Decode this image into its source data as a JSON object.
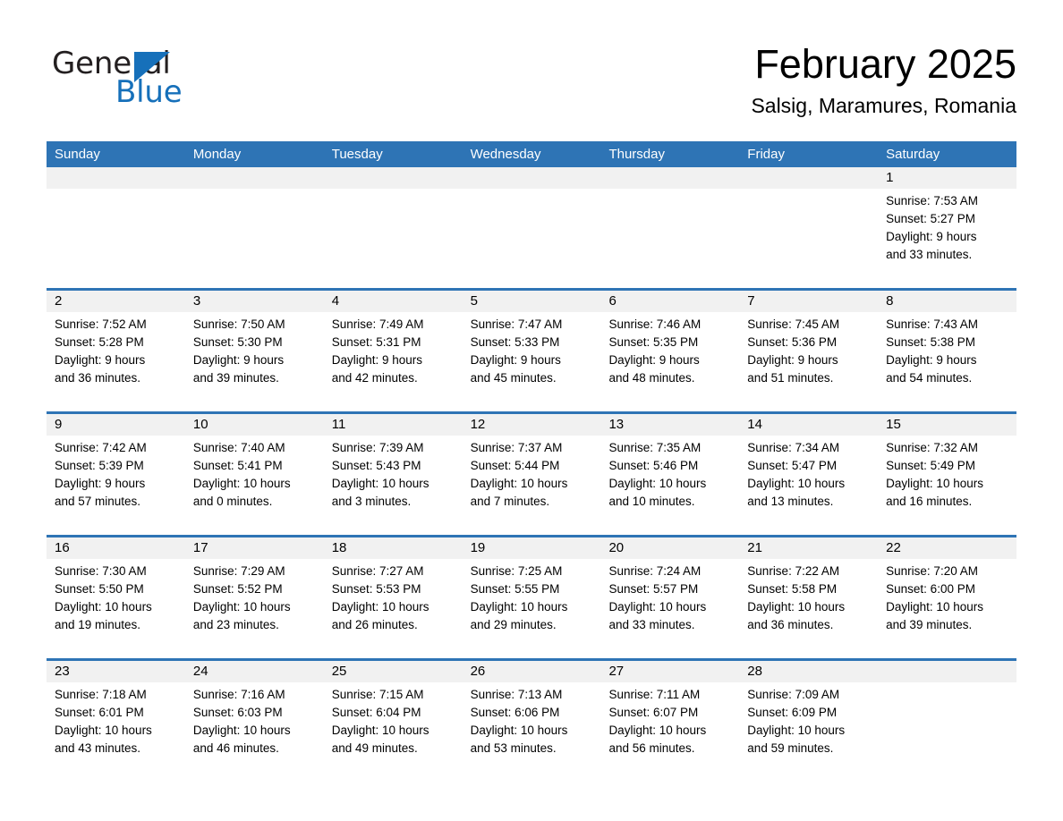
{
  "logo": {
    "word_one": "General",
    "word_two": "Blue",
    "triangle_icon": "triangle-icon",
    "accent_color": "#1670ba"
  },
  "header": {
    "title": "February 2025",
    "location": "Salsig, Maramures, Romania"
  },
  "calendar": {
    "header_bg": "#2e74b5",
    "date_band_bg": "#f1f1f1",
    "weekdays": [
      "Sunday",
      "Monday",
      "Tuesday",
      "Wednesday",
      "Thursday",
      "Friday",
      "Saturday"
    ],
    "weeks": [
      [
        {
          "day": "",
          "sunrise": "",
          "sunset": "",
          "daylight_line1": "",
          "daylight_line2": "",
          "empty": true
        },
        {
          "day": "",
          "sunrise": "",
          "sunset": "",
          "daylight_line1": "",
          "daylight_line2": "",
          "empty": true
        },
        {
          "day": "",
          "sunrise": "",
          "sunset": "",
          "daylight_line1": "",
          "daylight_line2": "",
          "empty": true
        },
        {
          "day": "",
          "sunrise": "",
          "sunset": "",
          "daylight_line1": "",
          "daylight_line2": "",
          "empty": true
        },
        {
          "day": "",
          "sunrise": "",
          "sunset": "",
          "daylight_line1": "",
          "daylight_line2": "",
          "empty": true
        },
        {
          "day": "",
          "sunrise": "",
          "sunset": "",
          "daylight_line1": "",
          "daylight_line2": "",
          "empty": true
        },
        {
          "day": "1",
          "sunrise": "Sunrise: 7:53 AM",
          "sunset": "Sunset: 5:27 PM",
          "daylight_line1": "Daylight: 9 hours",
          "daylight_line2": "and 33 minutes.",
          "empty": false
        }
      ],
      [
        {
          "day": "2",
          "sunrise": "Sunrise: 7:52 AM",
          "sunset": "Sunset: 5:28 PM",
          "daylight_line1": "Daylight: 9 hours",
          "daylight_line2": "and 36 minutes.",
          "empty": false
        },
        {
          "day": "3",
          "sunrise": "Sunrise: 7:50 AM",
          "sunset": "Sunset: 5:30 PM",
          "daylight_line1": "Daylight: 9 hours",
          "daylight_line2": "and 39 minutes.",
          "empty": false
        },
        {
          "day": "4",
          "sunrise": "Sunrise: 7:49 AM",
          "sunset": "Sunset: 5:31 PM",
          "daylight_line1": "Daylight: 9 hours",
          "daylight_line2": "and 42 minutes.",
          "empty": false
        },
        {
          "day": "5",
          "sunrise": "Sunrise: 7:47 AM",
          "sunset": "Sunset: 5:33 PM",
          "daylight_line1": "Daylight: 9 hours",
          "daylight_line2": "and 45 minutes.",
          "empty": false
        },
        {
          "day": "6",
          "sunrise": "Sunrise: 7:46 AM",
          "sunset": "Sunset: 5:35 PM",
          "daylight_line1": "Daylight: 9 hours",
          "daylight_line2": "and 48 minutes.",
          "empty": false
        },
        {
          "day": "7",
          "sunrise": "Sunrise: 7:45 AM",
          "sunset": "Sunset: 5:36 PM",
          "daylight_line1": "Daylight: 9 hours",
          "daylight_line2": "and 51 minutes.",
          "empty": false
        },
        {
          "day": "8",
          "sunrise": "Sunrise: 7:43 AM",
          "sunset": "Sunset: 5:38 PM",
          "daylight_line1": "Daylight: 9 hours",
          "daylight_line2": "and 54 minutes.",
          "empty": false
        }
      ],
      [
        {
          "day": "9",
          "sunrise": "Sunrise: 7:42 AM",
          "sunset": "Sunset: 5:39 PM",
          "daylight_line1": "Daylight: 9 hours",
          "daylight_line2": "and 57 minutes.",
          "empty": false
        },
        {
          "day": "10",
          "sunrise": "Sunrise: 7:40 AM",
          "sunset": "Sunset: 5:41 PM",
          "daylight_line1": "Daylight: 10 hours",
          "daylight_line2": "and 0 minutes.",
          "empty": false
        },
        {
          "day": "11",
          "sunrise": "Sunrise: 7:39 AM",
          "sunset": "Sunset: 5:43 PM",
          "daylight_line1": "Daylight: 10 hours",
          "daylight_line2": "and 3 minutes.",
          "empty": false
        },
        {
          "day": "12",
          "sunrise": "Sunrise: 7:37 AM",
          "sunset": "Sunset: 5:44 PM",
          "daylight_line1": "Daylight: 10 hours",
          "daylight_line2": "and 7 minutes.",
          "empty": false
        },
        {
          "day": "13",
          "sunrise": "Sunrise: 7:35 AM",
          "sunset": "Sunset: 5:46 PM",
          "daylight_line1": "Daylight: 10 hours",
          "daylight_line2": "and 10 minutes.",
          "empty": false
        },
        {
          "day": "14",
          "sunrise": "Sunrise: 7:34 AM",
          "sunset": "Sunset: 5:47 PM",
          "daylight_line1": "Daylight: 10 hours",
          "daylight_line2": "and 13 minutes.",
          "empty": false
        },
        {
          "day": "15",
          "sunrise": "Sunrise: 7:32 AM",
          "sunset": "Sunset: 5:49 PM",
          "daylight_line1": "Daylight: 10 hours",
          "daylight_line2": "and 16 minutes.",
          "empty": false
        }
      ],
      [
        {
          "day": "16",
          "sunrise": "Sunrise: 7:30 AM",
          "sunset": "Sunset: 5:50 PM",
          "daylight_line1": "Daylight: 10 hours",
          "daylight_line2": "and 19 minutes.",
          "empty": false
        },
        {
          "day": "17",
          "sunrise": "Sunrise: 7:29 AM",
          "sunset": "Sunset: 5:52 PM",
          "daylight_line1": "Daylight: 10 hours",
          "daylight_line2": "and 23 minutes.",
          "empty": false
        },
        {
          "day": "18",
          "sunrise": "Sunrise: 7:27 AM",
          "sunset": "Sunset: 5:53 PM",
          "daylight_line1": "Daylight: 10 hours",
          "daylight_line2": "and 26 minutes.",
          "empty": false
        },
        {
          "day": "19",
          "sunrise": "Sunrise: 7:25 AM",
          "sunset": "Sunset: 5:55 PM",
          "daylight_line1": "Daylight: 10 hours",
          "daylight_line2": "and 29 minutes.",
          "empty": false
        },
        {
          "day": "20",
          "sunrise": "Sunrise: 7:24 AM",
          "sunset": "Sunset: 5:57 PM",
          "daylight_line1": "Daylight: 10 hours",
          "daylight_line2": "and 33 minutes.",
          "empty": false
        },
        {
          "day": "21",
          "sunrise": "Sunrise: 7:22 AM",
          "sunset": "Sunset: 5:58 PM",
          "daylight_line1": "Daylight: 10 hours",
          "daylight_line2": "and 36 minutes.",
          "empty": false
        },
        {
          "day": "22",
          "sunrise": "Sunrise: 7:20 AM",
          "sunset": "Sunset: 6:00 PM",
          "daylight_line1": "Daylight: 10 hours",
          "daylight_line2": "and 39 minutes.",
          "empty": false
        }
      ],
      [
        {
          "day": "23",
          "sunrise": "Sunrise: 7:18 AM",
          "sunset": "Sunset: 6:01 PM",
          "daylight_line1": "Daylight: 10 hours",
          "daylight_line2": "and 43 minutes.",
          "empty": false
        },
        {
          "day": "24",
          "sunrise": "Sunrise: 7:16 AM",
          "sunset": "Sunset: 6:03 PM",
          "daylight_line1": "Daylight: 10 hours",
          "daylight_line2": "and 46 minutes.",
          "empty": false
        },
        {
          "day": "25",
          "sunrise": "Sunrise: 7:15 AM",
          "sunset": "Sunset: 6:04 PM",
          "daylight_line1": "Daylight: 10 hours",
          "daylight_line2": "and 49 minutes.",
          "empty": false
        },
        {
          "day": "26",
          "sunrise": "Sunrise: 7:13 AM",
          "sunset": "Sunset: 6:06 PM",
          "daylight_line1": "Daylight: 10 hours",
          "daylight_line2": "and 53 minutes.",
          "empty": false
        },
        {
          "day": "27",
          "sunrise": "Sunrise: 7:11 AM",
          "sunset": "Sunset: 6:07 PM",
          "daylight_line1": "Daylight: 10 hours",
          "daylight_line2": "and 56 minutes.",
          "empty": false
        },
        {
          "day": "28",
          "sunrise": "Sunrise: 7:09 AM",
          "sunset": "Sunset: 6:09 PM",
          "daylight_line1": "Daylight: 10 hours",
          "daylight_line2": "and 59 minutes.",
          "empty": false
        },
        {
          "day": "",
          "sunrise": "",
          "sunset": "",
          "daylight_line1": "",
          "daylight_line2": "",
          "empty": true
        }
      ]
    ]
  }
}
